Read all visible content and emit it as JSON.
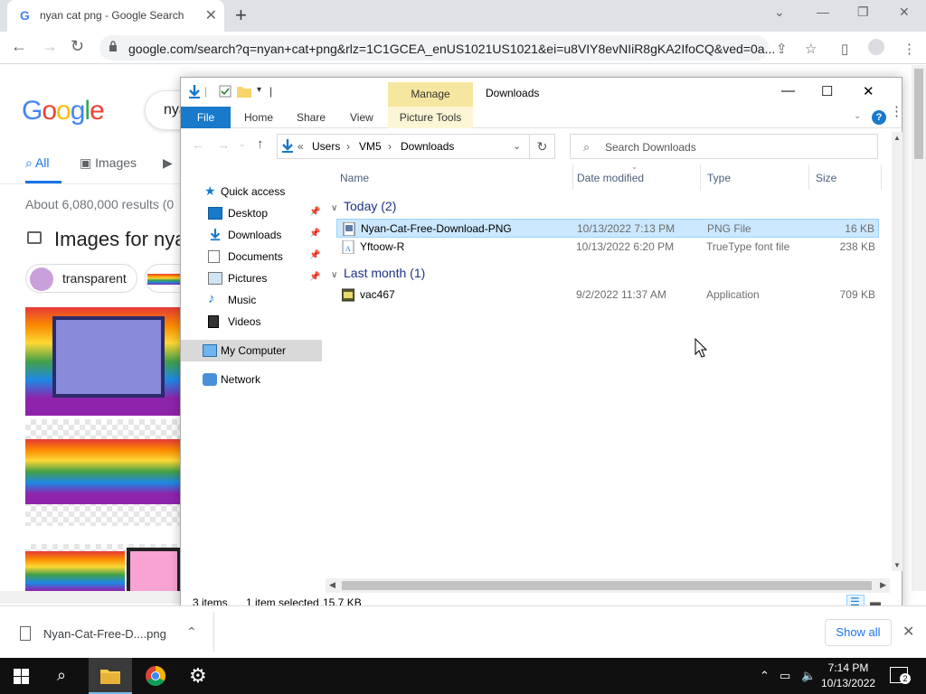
{
  "browser": {
    "tab_title": "nyan cat png - Google Search",
    "url": "google.com/search?q=nyan+cat+png&rlz=1C1GCEA_enUS1021US1021&ei=u8VIY8evNIiR8gKA2IfoCQ&ved=0a..."
  },
  "google": {
    "search_text": "nya",
    "tabs": [
      "All",
      "Images"
    ],
    "results": "About 6,080,000 results (0",
    "images_for": "Images for nya",
    "chip_transparent": "transparent"
  },
  "explorer": {
    "manage_label": "Manage",
    "title": "Downloads",
    "ribbon": {
      "file": "File",
      "home": "Home",
      "share": "Share",
      "view": "View",
      "picture_tools": "Picture Tools"
    },
    "breadcrumb": [
      "Users",
      "VM5",
      "Downloads"
    ],
    "search_placeholder": "Search Downloads",
    "nav": {
      "quick_access": "Quick access",
      "desktop": "Desktop",
      "downloads": "Downloads",
      "documents": "Documents",
      "pictures": "Pictures",
      "music": "Music",
      "videos": "Videos",
      "my_computer": "My Computer",
      "network": "Network"
    },
    "columns": {
      "name": "Name",
      "date": "Date modified",
      "type": "Type",
      "size": "Size"
    },
    "groups": {
      "today": "Today (2)",
      "last_month": "Last month (1)"
    },
    "files": [
      {
        "name": "Nyan-Cat-Free-Download-PNG",
        "date": "10/13/2022 7:13 PM",
        "type": "PNG File",
        "size": "16 KB"
      },
      {
        "name": "Yftoow-R",
        "date": "10/13/2022 6:20 PM",
        "type": "TrueType font file",
        "size": "238 KB"
      },
      {
        "name": "vac467",
        "date": "9/2/2022 11:37 AM",
        "type": "Application",
        "size": "709 KB"
      }
    ],
    "status": {
      "items": "3 items",
      "selected": "1 item selected",
      "size": "15.7 KB"
    }
  },
  "shelf": {
    "download_name": "Nyan-Cat-Free-D....png",
    "show_all": "Show all"
  },
  "taskbar": {
    "time": "7:14 PM",
    "date": "10/13/2022",
    "notifications": "2"
  }
}
